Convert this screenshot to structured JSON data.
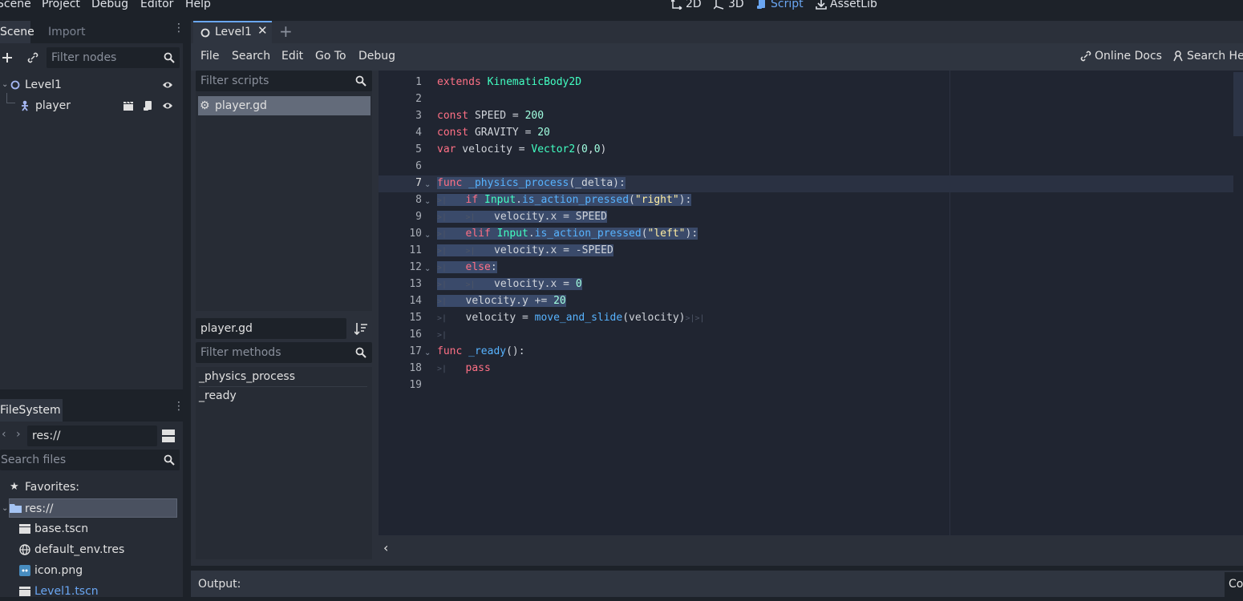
{
  "menu": [
    "Scene",
    "Project",
    "Debug",
    "Editor",
    "Help"
  ],
  "workspaces": [
    {
      "label": "2D",
      "icon": "2d-icon",
      "active": false
    },
    {
      "label": "3D",
      "icon": "3d-icon",
      "active": false
    },
    {
      "label": "Script",
      "icon": "script-icon",
      "active": true
    },
    {
      "label": "AssetLib",
      "icon": "assetlib-icon",
      "active": false
    }
  ],
  "scene_dock": {
    "tabs": [
      "Scene",
      "Import"
    ],
    "filter_placeholder": "Filter nodes",
    "tree": [
      {
        "label": "Level1",
        "icon": "node2d-icon"
      },
      {
        "label": "player",
        "icon": "kinematic-body-icon"
      }
    ]
  },
  "filesystem_dock": {
    "tab": "FileSystem",
    "path": "res://",
    "search_placeholder": "Search files",
    "favorites_label": "Favorites:",
    "root": "res://",
    "files": [
      {
        "label": "base.tscn",
        "icon": "scene-file-icon",
        "highlight": false
      },
      {
        "label": "default_env.tres",
        "icon": "environment-icon",
        "highlight": false
      },
      {
        "label": "icon.png",
        "icon": "image-file-icon",
        "highlight": false
      },
      {
        "label": "Level1.tscn",
        "icon": "scene-file-icon",
        "highlight": true
      }
    ]
  },
  "editor_tab": {
    "label": "Level1"
  },
  "script_menu": [
    "File",
    "Search",
    "Edit",
    "Go To",
    "Debug"
  ],
  "script_links": [
    "Online Docs",
    "Search He"
  ],
  "scripts_panel": {
    "filter_placeholder": "Filter scripts",
    "scripts": [
      "player.gd"
    ],
    "current_script": "player.gd",
    "methods_placeholder": "Filter methods",
    "methods": [
      "_physics_process",
      "_ready"
    ]
  },
  "code": {
    "line_numbers": [
      "1",
      "2",
      "3",
      "4",
      "5",
      "6",
      "7",
      "8",
      "9",
      "10",
      "11",
      "12",
      "13",
      "14",
      "15",
      "16",
      "17",
      "18",
      "19"
    ],
    "current_line": 7
  },
  "output": {
    "label": "Output:",
    "right_label": "Co"
  },
  "colors": {
    "accent": "#6aa6f2",
    "keyword": "#ff7085",
    "type": "#42ffc2",
    "number": "#a1ffe0",
    "function": "#57b3ff",
    "string": "#ffeda1"
  }
}
